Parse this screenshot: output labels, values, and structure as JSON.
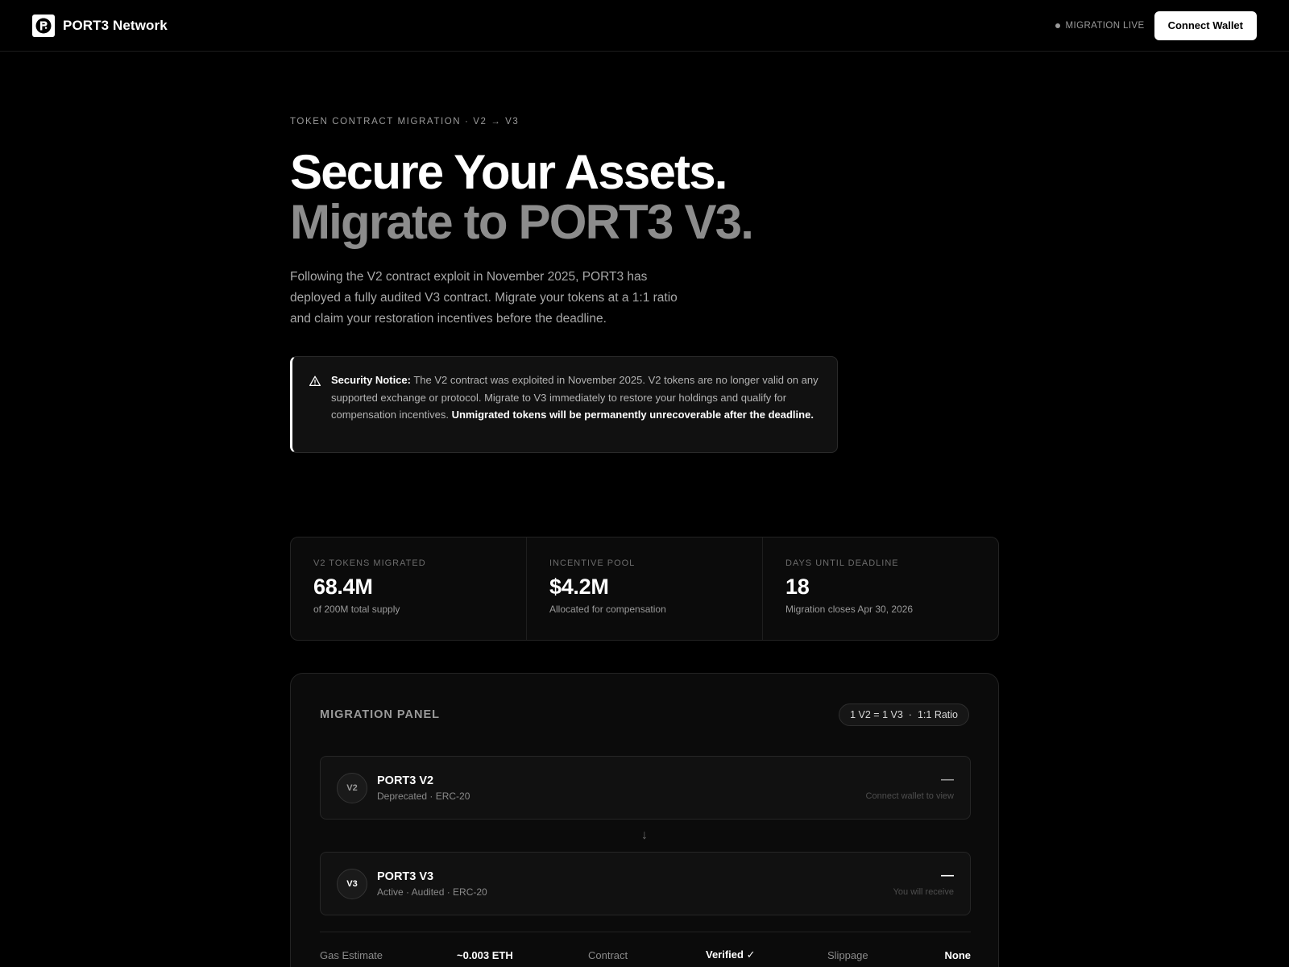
{
  "header": {
    "brand_name": "PORT3 Network",
    "live_status": "MIGRATION LIVE",
    "connect_label": "Connect Wallet"
  },
  "hero": {
    "eyebrow": "TOKEN CONTRACT MIGRATION · V2 → V3",
    "headline_line1": "Secure Your Assets.",
    "headline_line2": "Migrate to PORT3 V3.",
    "lead": "Following the V2 contract exploit in November 2025, PORT3 has deployed a fully audited V3 contract. Migrate your tokens at a 1:1 ratio and claim your restoration incentives before the deadline."
  },
  "notice": {
    "title": "Security Notice:",
    "body": " The V2 contract was exploited in November 2025. V2 tokens are no longer valid on any supported exchange or protocol. Migrate to V3 immediately to restore your holdings and qualify for compensation incentives. ",
    "emphasis": "Unmigrated tokens will be permanently unrecoverable after the deadline."
  },
  "stats": [
    {
      "label": "V2 TOKENS MIGRATED",
      "value": "68.4M",
      "sub": "of 200M total supply"
    },
    {
      "label": "INCENTIVE POOL",
      "value": "$4.2M",
      "sub": "Allocated for compensation"
    },
    {
      "label": "DAYS UNTIL DEADLINE",
      "value": "18",
      "sub": "Migration closes Apr 30, 2026"
    }
  ],
  "panel": {
    "title": "MIGRATION PANEL",
    "ratio_left": "1 V2 = 1 V3",
    "ratio_sep": "·",
    "ratio_right": "1:1 Ratio",
    "from_token": {
      "badge": "V2",
      "name": "PORT3 V2",
      "sub": "Deprecated · ERC-20",
      "amount": "—",
      "hint": "Connect wallet to view"
    },
    "arrow": "↓",
    "to_token": {
      "badge": "V3",
      "name": "PORT3 V3",
      "sub": "Active · Audited · ERC-20",
      "amount": "—",
      "hint": "You will receive"
    },
    "meta": {
      "gas_label": "Gas Estimate",
      "gas_value": "~0.003 ETH",
      "contract_label": "Contract",
      "contract_value": "Verified ✓",
      "slippage_label": "Slippage",
      "slippage_value": "None"
    }
  }
}
